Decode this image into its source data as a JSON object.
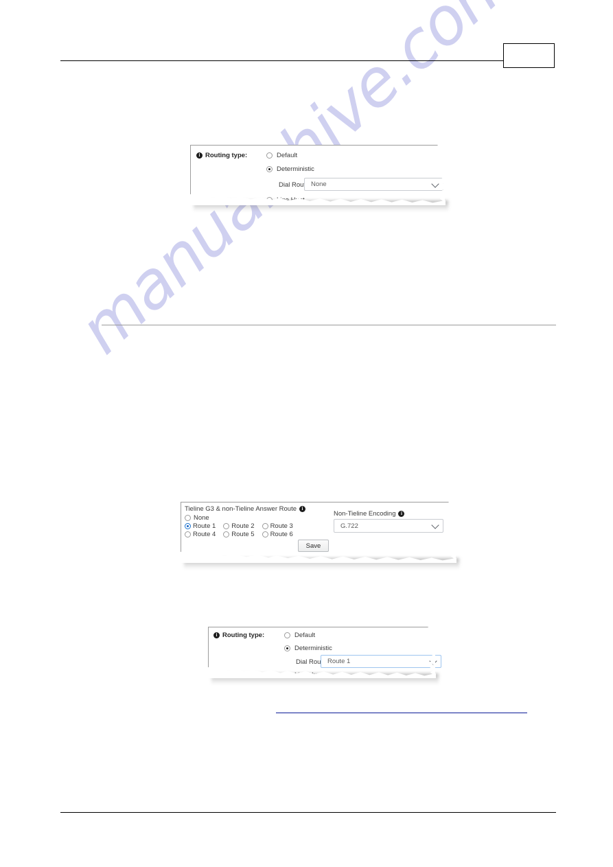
{
  "document": {
    "watermark": "manualshive.com",
    "page_number": ""
  },
  "panel_routing_none": {
    "info_icon": "info-icon",
    "title": "Routing type:",
    "options": [
      {
        "label": "Default",
        "selected": false
      },
      {
        "label": "Deterministic",
        "selected": true
      },
      {
        "label": "Line Hunt",
        "selected": false
      }
    ],
    "dial_route": {
      "label": "Dial Route:",
      "value": "None",
      "chevron": "chevron-down-icon"
    }
  },
  "panel_answer_route": {
    "title": "Tieline G3 & non-Tieline Answer Route",
    "title_info_icon": "info-icon",
    "options": [
      {
        "label": "None",
        "selected": false
      },
      {
        "label": "Route 1",
        "selected": true
      },
      {
        "label": "Route 2",
        "selected": false
      },
      {
        "label": "Route 3",
        "selected": false
      },
      {
        "label": "Route 4",
        "selected": false
      },
      {
        "label": "Route 5",
        "selected": false
      },
      {
        "label": "Route 6",
        "selected": false
      }
    ],
    "encoding": {
      "label": "Non-Tieline Encoding",
      "info_icon": "info-icon",
      "value": "G.722",
      "chevron": "chevron-down-icon"
    },
    "save_label": "Save"
  },
  "panel_routing_route1": {
    "info_icon": "info-icon",
    "title": "Routing type:",
    "options": [
      {
        "label": "Default",
        "selected": false
      },
      {
        "label": "Deterministic",
        "selected": true
      },
      {
        "label": "Line Hunt",
        "selected": false
      }
    ],
    "dial_route": {
      "label": "Dial Route:",
      "value": "Route 1",
      "chevron": "chevron-down-icon"
    }
  },
  "colors": {
    "watermark": "#c7c8ee",
    "link_underline": "#0b1a96",
    "selected_radio_blue": "#1464c8",
    "rule_black": "#000000",
    "rule_gray": "#9a9a9a"
  }
}
